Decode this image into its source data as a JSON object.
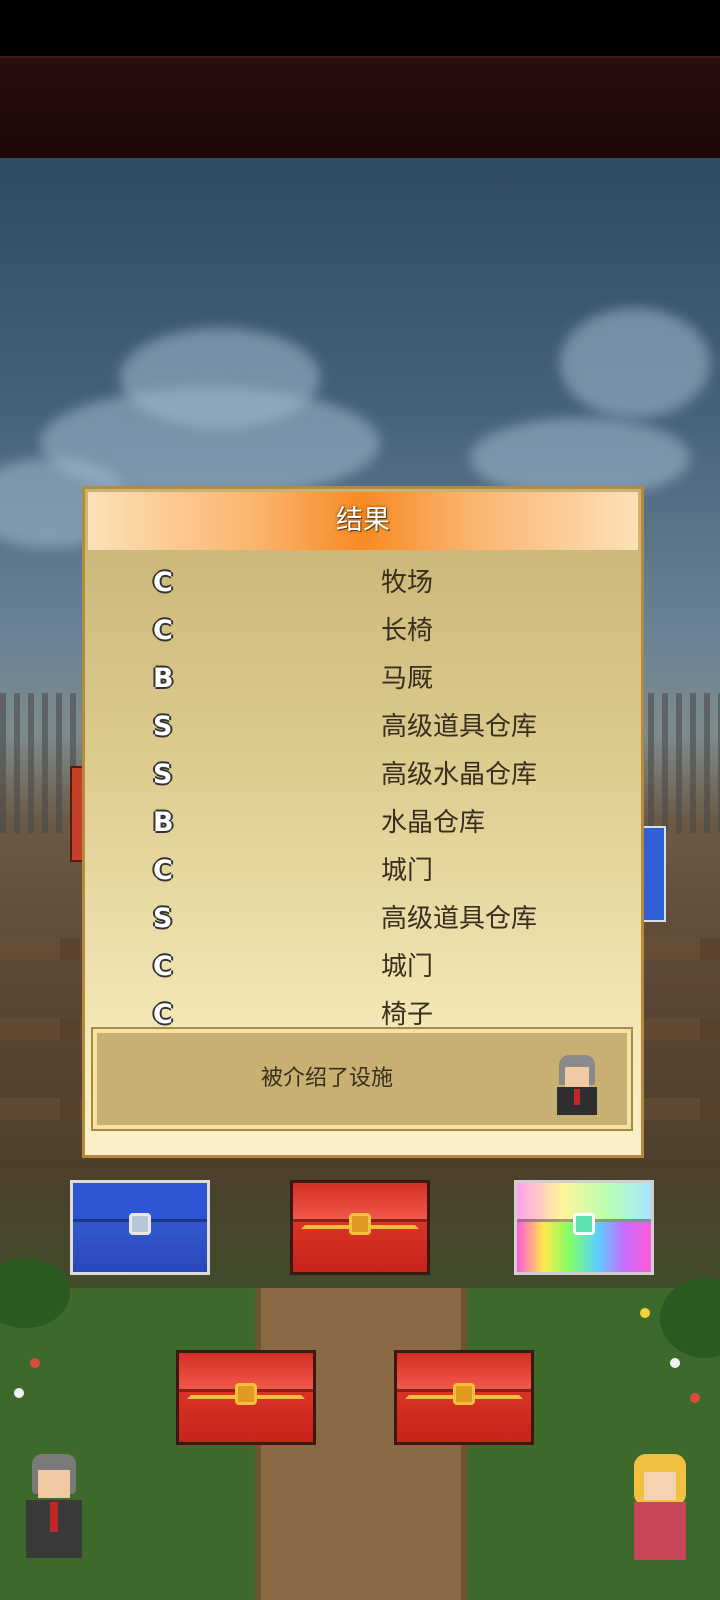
{
  "dialog": {
    "title": "结果",
    "results": [
      {
        "rank": "C",
        "facility": "牧场"
      },
      {
        "rank": "C",
        "facility": "长椅"
      },
      {
        "rank": "B",
        "facility": "马厩"
      },
      {
        "rank": "S",
        "facility": "高级道具仓库"
      },
      {
        "rank": "S",
        "facility": "高级水晶仓库"
      },
      {
        "rank": "B",
        "facility": "水晶仓库"
      },
      {
        "rank": "C",
        "facility": "城门"
      },
      {
        "rank": "S",
        "facility": "高级道具仓库"
      },
      {
        "rank": "C",
        "facility": "城门"
      },
      {
        "rank": "C",
        "facility": "椅子"
      }
    ],
    "message": "被介绍了设施"
  },
  "chests": {
    "row1": [
      "blue",
      "red",
      "rainbow"
    ],
    "row2": [
      "red",
      "red"
    ]
  },
  "colors": {
    "title_gradient_center": "#f78a24",
    "panel_bg": "#fbf0c8",
    "panel_border": "#b58a3c",
    "message_box": "#c7b071"
  }
}
